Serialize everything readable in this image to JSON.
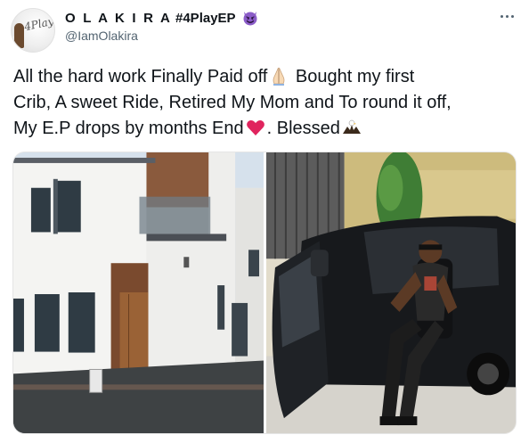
{
  "author": {
    "display_name": "O L A K I R A",
    "display_tag": "#4PlayEP",
    "handle": "@IamOlakira",
    "avatar_signature": "4Play",
    "emoji": "smiling-face-with-horns-icon"
  },
  "tweet": {
    "line1_a": "All the hard work Finally Paid off",
    "line1_b": " Bought my first",
    "line2": "Crib, A sweet Ride, Retired My Mom and To round it off,",
    "line3_a": "My E.P drops by months End",
    "line3_b": ". Blessed",
    "emojis": [
      "folded-hands-icon",
      "red-heart-icon",
      "eagle-icon"
    ]
  },
  "media": {
    "photos": [
      {
        "subject": "house-photo"
      },
      {
        "subject": "car-photo"
      }
    ]
  },
  "colors": {
    "text": "#0f1419",
    "secondary": "#536471",
    "devil": "#8b5cc8",
    "heart": "#e0245e"
  }
}
